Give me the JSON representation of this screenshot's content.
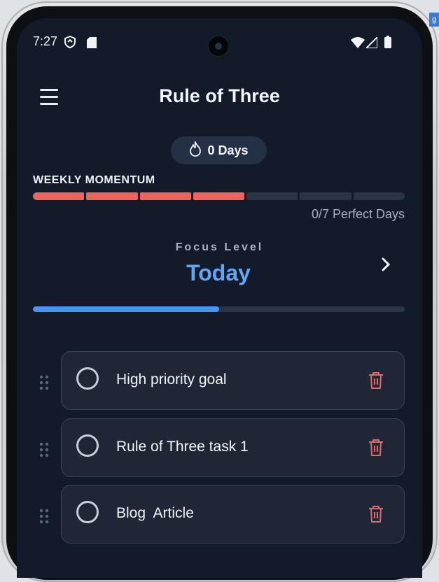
{
  "status_bar": {
    "time": "7:27",
    "icons": [
      "shield-icon",
      "sd-card-icon",
      "wifi-icon",
      "signal-icon",
      "battery-icon"
    ]
  },
  "edge_badge": "g",
  "header": {
    "title": "Rule of Three",
    "menu_icon": "hamburger-menu-icon"
  },
  "streak": {
    "icon": "flame-icon",
    "label": "0 Days"
  },
  "weekly_momentum": {
    "label": "WEEKLY MOMENTUM",
    "segments_filled": 4,
    "segments_total": 7,
    "filled_color": "#f0625f",
    "empty_color": "#2b3445",
    "summary": "0/7 Perfect Days"
  },
  "focus": {
    "label": "Focus Level",
    "value": "Today",
    "next_icon": "chevron-right-icon",
    "progress": 0.5,
    "accent_color": "#63a4f5"
  },
  "tasks": [
    {
      "text": "High priority goal",
      "completed": false
    },
    {
      "text": "Rule of Three task 1",
      "completed": false
    },
    {
      "text": "Blog  Article",
      "completed": false
    }
  ],
  "colors": {
    "background": "#131a2a",
    "card": "#1f2635",
    "delete": "#e06a66"
  }
}
